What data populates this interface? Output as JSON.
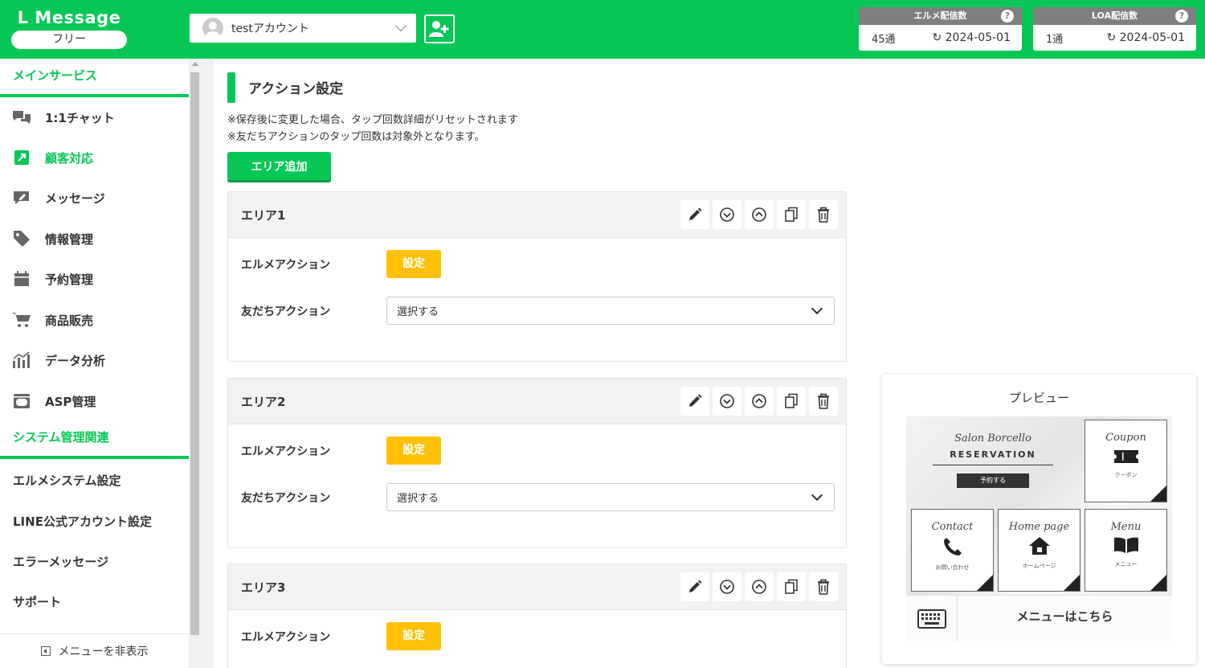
{
  "header": {
    "logo_title": "L Message",
    "logo_plan": "フリー",
    "account_name": "testアカウント",
    "stats": [
      {
        "title": "エルメ配信数",
        "count": "45通",
        "date": "2024-05-01"
      },
      {
        "title": "LOA配信数",
        "count": "1通",
        "date": "2024-05-01"
      }
    ]
  },
  "sidebar": {
    "section_main": "メインサービス",
    "items": [
      {
        "label": "1:1チャット",
        "icon": "chat-icon"
      },
      {
        "label": "顧客対応",
        "icon": "customer-arrow-icon"
      },
      {
        "label": "メッセージ",
        "icon": "message-edit-icon"
      },
      {
        "label": "情報管理",
        "icon": "tag-icon"
      },
      {
        "label": "予約管理",
        "icon": "calendar-icon"
      },
      {
        "label": "商品販売",
        "icon": "cart-icon"
      },
      {
        "label": "データ分析",
        "icon": "chart-icon"
      },
      {
        "label": "ASP管理",
        "icon": "asp-icon"
      }
    ],
    "section_system": "システム管理関連",
    "system_items": [
      "エルメシステム設定",
      "LINE公式アカウント設定",
      "エラーメッセージ",
      "サポート"
    ],
    "hide_menu": "メニューを非表示"
  },
  "main": {
    "title": "アクション設定",
    "notes": [
      "※保存後に変更した場合、タップ回数詳細がリセットされます",
      "※友だちアクションのタップ回数は対象外となります。"
    ],
    "add_area": "エリア追加",
    "areas": [
      {
        "name": "エリア1",
        "lme_label": "エルメアクション",
        "set_label": "設定",
        "friend_label": "友だちアクション",
        "select_value": "選択する"
      },
      {
        "name": "エリア2",
        "lme_label": "エルメアクション",
        "set_label": "設定",
        "friend_label": "友だちアクション",
        "select_value": "選択する"
      },
      {
        "name": "エリア3",
        "lme_label": "エルメアクション",
        "set_label": "設定"
      }
    ]
  },
  "preview": {
    "title": "プレビュー",
    "reserve_script": "Salon Borcello",
    "reserve_title": "RESERVATION",
    "reserve_button": "予約する",
    "cells": [
      {
        "script": "Coupon",
        "label": "クーポン"
      },
      {
        "script": "Contact",
        "label": "お問い合わせ"
      },
      {
        "script": "Home page",
        "label": "ホームページ"
      },
      {
        "script": "Menu",
        "label": "メニュー"
      }
    ],
    "menu_text": "メニューはこちら"
  },
  "colors": {
    "brand": "#06c755",
    "set_button": "#ffc107"
  }
}
